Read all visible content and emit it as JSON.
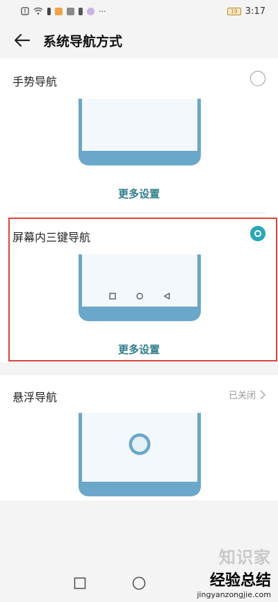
{
  "status_bar": {
    "time": "3:17",
    "battery": "19",
    "more": "···"
  },
  "header": {
    "title": "系统导航方式"
  },
  "options": [
    {
      "label": "手势导航",
      "more_label": "更多设置",
      "selected": false
    },
    {
      "label": "屏幕内三键导航",
      "more_label": "更多设置",
      "selected": true
    },
    {
      "label": "悬浮导航",
      "status": "已关闭"
    }
  ],
  "watermark": {
    "brand_faint": "知识家",
    "brand": "经验总结",
    "url": "jingyanzongjie.com"
  },
  "colors": {
    "accent": "#2aa6b8",
    "link": "#2f7e8c",
    "phone": "#6aa7c9",
    "highlight_border": "#d8443a"
  }
}
